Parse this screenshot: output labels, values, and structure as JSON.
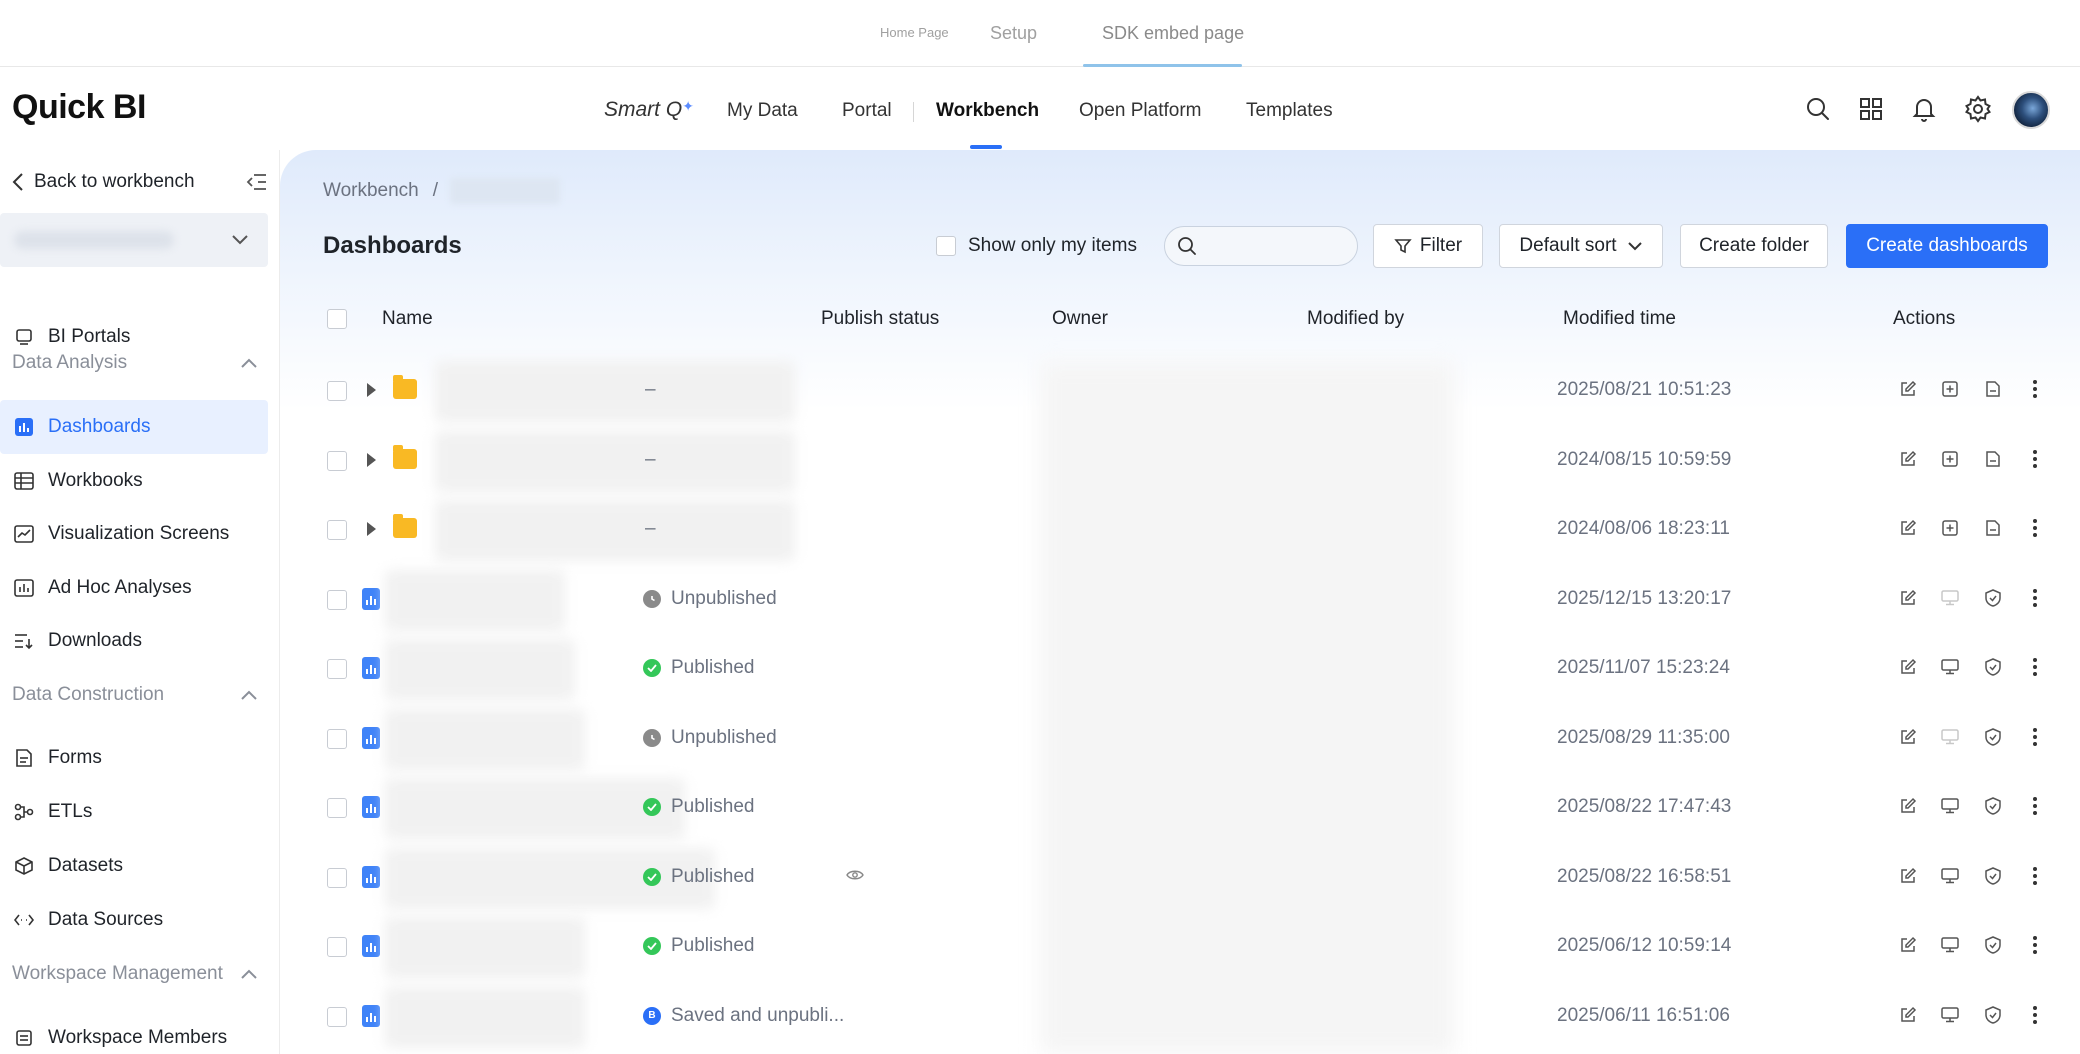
{
  "sdk_tabs": {
    "home": "Home Page",
    "setup": "Setup",
    "embed": "SDK embed page"
  },
  "header": {
    "logo": "Quick BI",
    "smart": "Smart Q",
    "nav": {
      "my_data": "My Data",
      "portal": "Portal",
      "workbench": "Workbench",
      "open_platform": "Open Platform",
      "templates": "Templates"
    }
  },
  "sidebar": {
    "back": "Back to workbench",
    "bi_portals": "BI Portals",
    "data_analysis": "Data Analysis",
    "dashboards": "Dashboards",
    "workbooks": "Workbooks",
    "visualization_screens": "Visualization Screens",
    "ad_hoc_analyses": "Ad Hoc Analyses",
    "downloads": "Downloads",
    "data_construction": "Data Construction",
    "forms": "Forms",
    "etls": "ETLs",
    "datasets": "Datasets",
    "data_sources": "Data Sources",
    "workspace_management": "Workspace Management",
    "workspace_members": "Workspace Members"
  },
  "main": {
    "breadcrumb_root": "Workbench",
    "breadcrumb_sep": "/",
    "title": "Dashboards",
    "show_only_mine": "Show only my items",
    "search_placeholder": "",
    "filter": "Filter",
    "sort": "Default sort",
    "create_folder": "Create folder",
    "create_dashboards": "Create dashboards"
  },
  "table": {
    "columns": {
      "name": "Name",
      "publish_status": "Publish status",
      "owner": "Owner",
      "modified_by": "Modified by",
      "modified_time": "Modified time",
      "actions": "Actions"
    },
    "rows": [
      {
        "type": "folder",
        "status": "–",
        "time": "2025/08/21 10:51:23"
      },
      {
        "type": "folder",
        "status": "–",
        "time": "2024/08/15 10:59:59"
      },
      {
        "type": "folder",
        "status": "–",
        "time": "2024/08/06 18:23:11"
      },
      {
        "type": "dashboard",
        "status": "Unpublished",
        "time": "2025/12/15 13:20:17"
      },
      {
        "type": "dashboard",
        "status": "Published",
        "time": "2025/11/07 15:23:24"
      },
      {
        "type": "dashboard",
        "status": "Unpublished",
        "time": "2025/08/29 11:35:00"
      },
      {
        "type": "dashboard",
        "status": "Published",
        "time": "2025/08/22 17:47:43"
      },
      {
        "type": "dashboard",
        "status": "Published",
        "time": "2025/08/22 16:58:51"
      },
      {
        "type": "dashboard",
        "status": "Published",
        "time": "2025/06/12 10:59:14"
      },
      {
        "type": "dashboard",
        "status": "Saved and unpubli...",
        "time": "2025/06/11 16:51:06"
      }
    ]
  },
  "colors": {
    "accent": "#2a6ff7",
    "published": "#34c759",
    "unpublished": "#8a8a8a",
    "folder": "#f9b924"
  }
}
